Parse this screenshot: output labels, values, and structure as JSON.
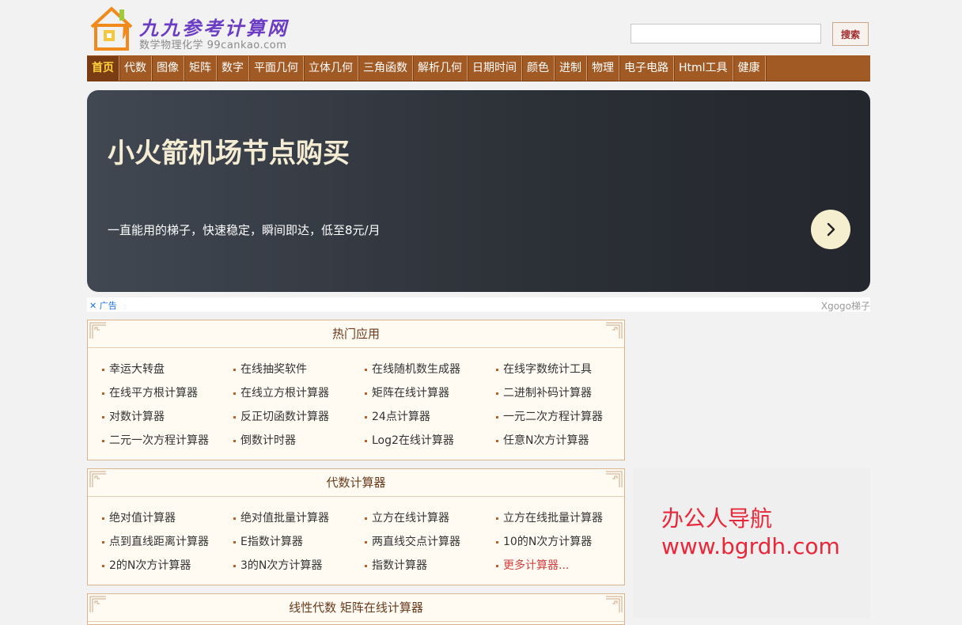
{
  "header": {
    "logo_title": "九九参考计算网",
    "logo_subtitle": "数学物理化学 99cankao.com",
    "search_placeholder": "",
    "search_button": "搜索"
  },
  "nav": [
    {
      "label": "首页",
      "active": true
    },
    {
      "label": "代数"
    },
    {
      "label": "图像"
    },
    {
      "label": "矩阵"
    },
    {
      "label": "数字"
    },
    {
      "label": "平面几何"
    },
    {
      "label": "立体几何"
    },
    {
      "label": "三角函数"
    },
    {
      "label": "解析几何"
    },
    {
      "label": "日期时间"
    },
    {
      "label": "颜色"
    },
    {
      "label": "进制"
    },
    {
      "label": "物理"
    },
    {
      "label": "电子电路"
    },
    {
      "label": "Html工具"
    },
    {
      "label": "健康"
    }
  ],
  "ad": {
    "title": "小火箭机场节点购买",
    "desc": "一直能用的梯子，快速稳定，瞬间即达，低至8元/月",
    "ad_label": "广告",
    "source": "Xgogo梯子"
  },
  "panels": [
    {
      "title": "热门应用",
      "items": [
        "幸运大转盘",
        "在线抽奖软件",
        "在线随机数生成器",
        "在线字数统计工具",
        "在线平方根计算器",
        "在线立方根计算器",
        "矩阵在线计算器",
        "二进制补码计算器",
        "对数计算器",
        "反正切函数计算器",
        "24点计算器",
        "一元二次方程计算器",
        "二元一次方程计算器",
        "倒数计时器",
        "Log2在线计算器",
        "任意N次方计算器"
      ]
    },
    {
      "title": "代数计算器",
      "items": [
        "绝对值计算器",
        "绝对值批量计算器",
        "立方在线计算器",
        "立方在线批量计算器",
        "点到直线距离计算器",
        "E指数计算器",
        "两直线交点计算器",
        "10的N次方计算器",
        "2的N次方计算器",
        "3的N次方计算器",
        "指数计算器",
        "更多计算器..."
      ]
    },
    {
      "title": "线性代数 矩阵在线计算器",
      "items": []
    }
  ],
  "side_ad": {
    "line1": "办公人导航",
    "line2": "www.bgrdh.com"
  },
  "colors": {
    "nav_bg": "#a25a24",
    "nav_active": "#7a3c12",
    "nav_active_text": "#ffd23f",
    "panel_bg": "#fffbf3",
    "more_link": "#d23f3f"
  }
}
